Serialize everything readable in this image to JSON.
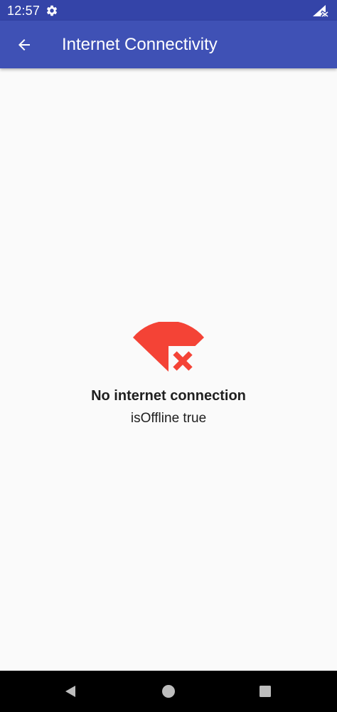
{
  "status_bar": {
    "time": "12:57",
    "icons": [
      "gear-icon",
      "signal-no-data-icon"
    ]
  },
  "app_bar": {
    "title": "Internet Connectivity",
    "back_icon": "arrow-back-icon"
  },
  "main": {
    "icon": "wifi-off-icon",
    "title": "No internet connection",
    "status": "isOffline true"
  },
  "nav_bar": {
    "icons": [
      "nav-back-icon",
      "nav-home-icon",
      "nav-recents-icon"
    ]
  },
  "colors": {
    "status_bar": "#3444a8",
    "app_bar": "#3f51b5",
    "background": "#fafafa",
    "offline_red": "#f44336",
    "text": "#202020",
    "nav_bar": "#000000"
  }
}
